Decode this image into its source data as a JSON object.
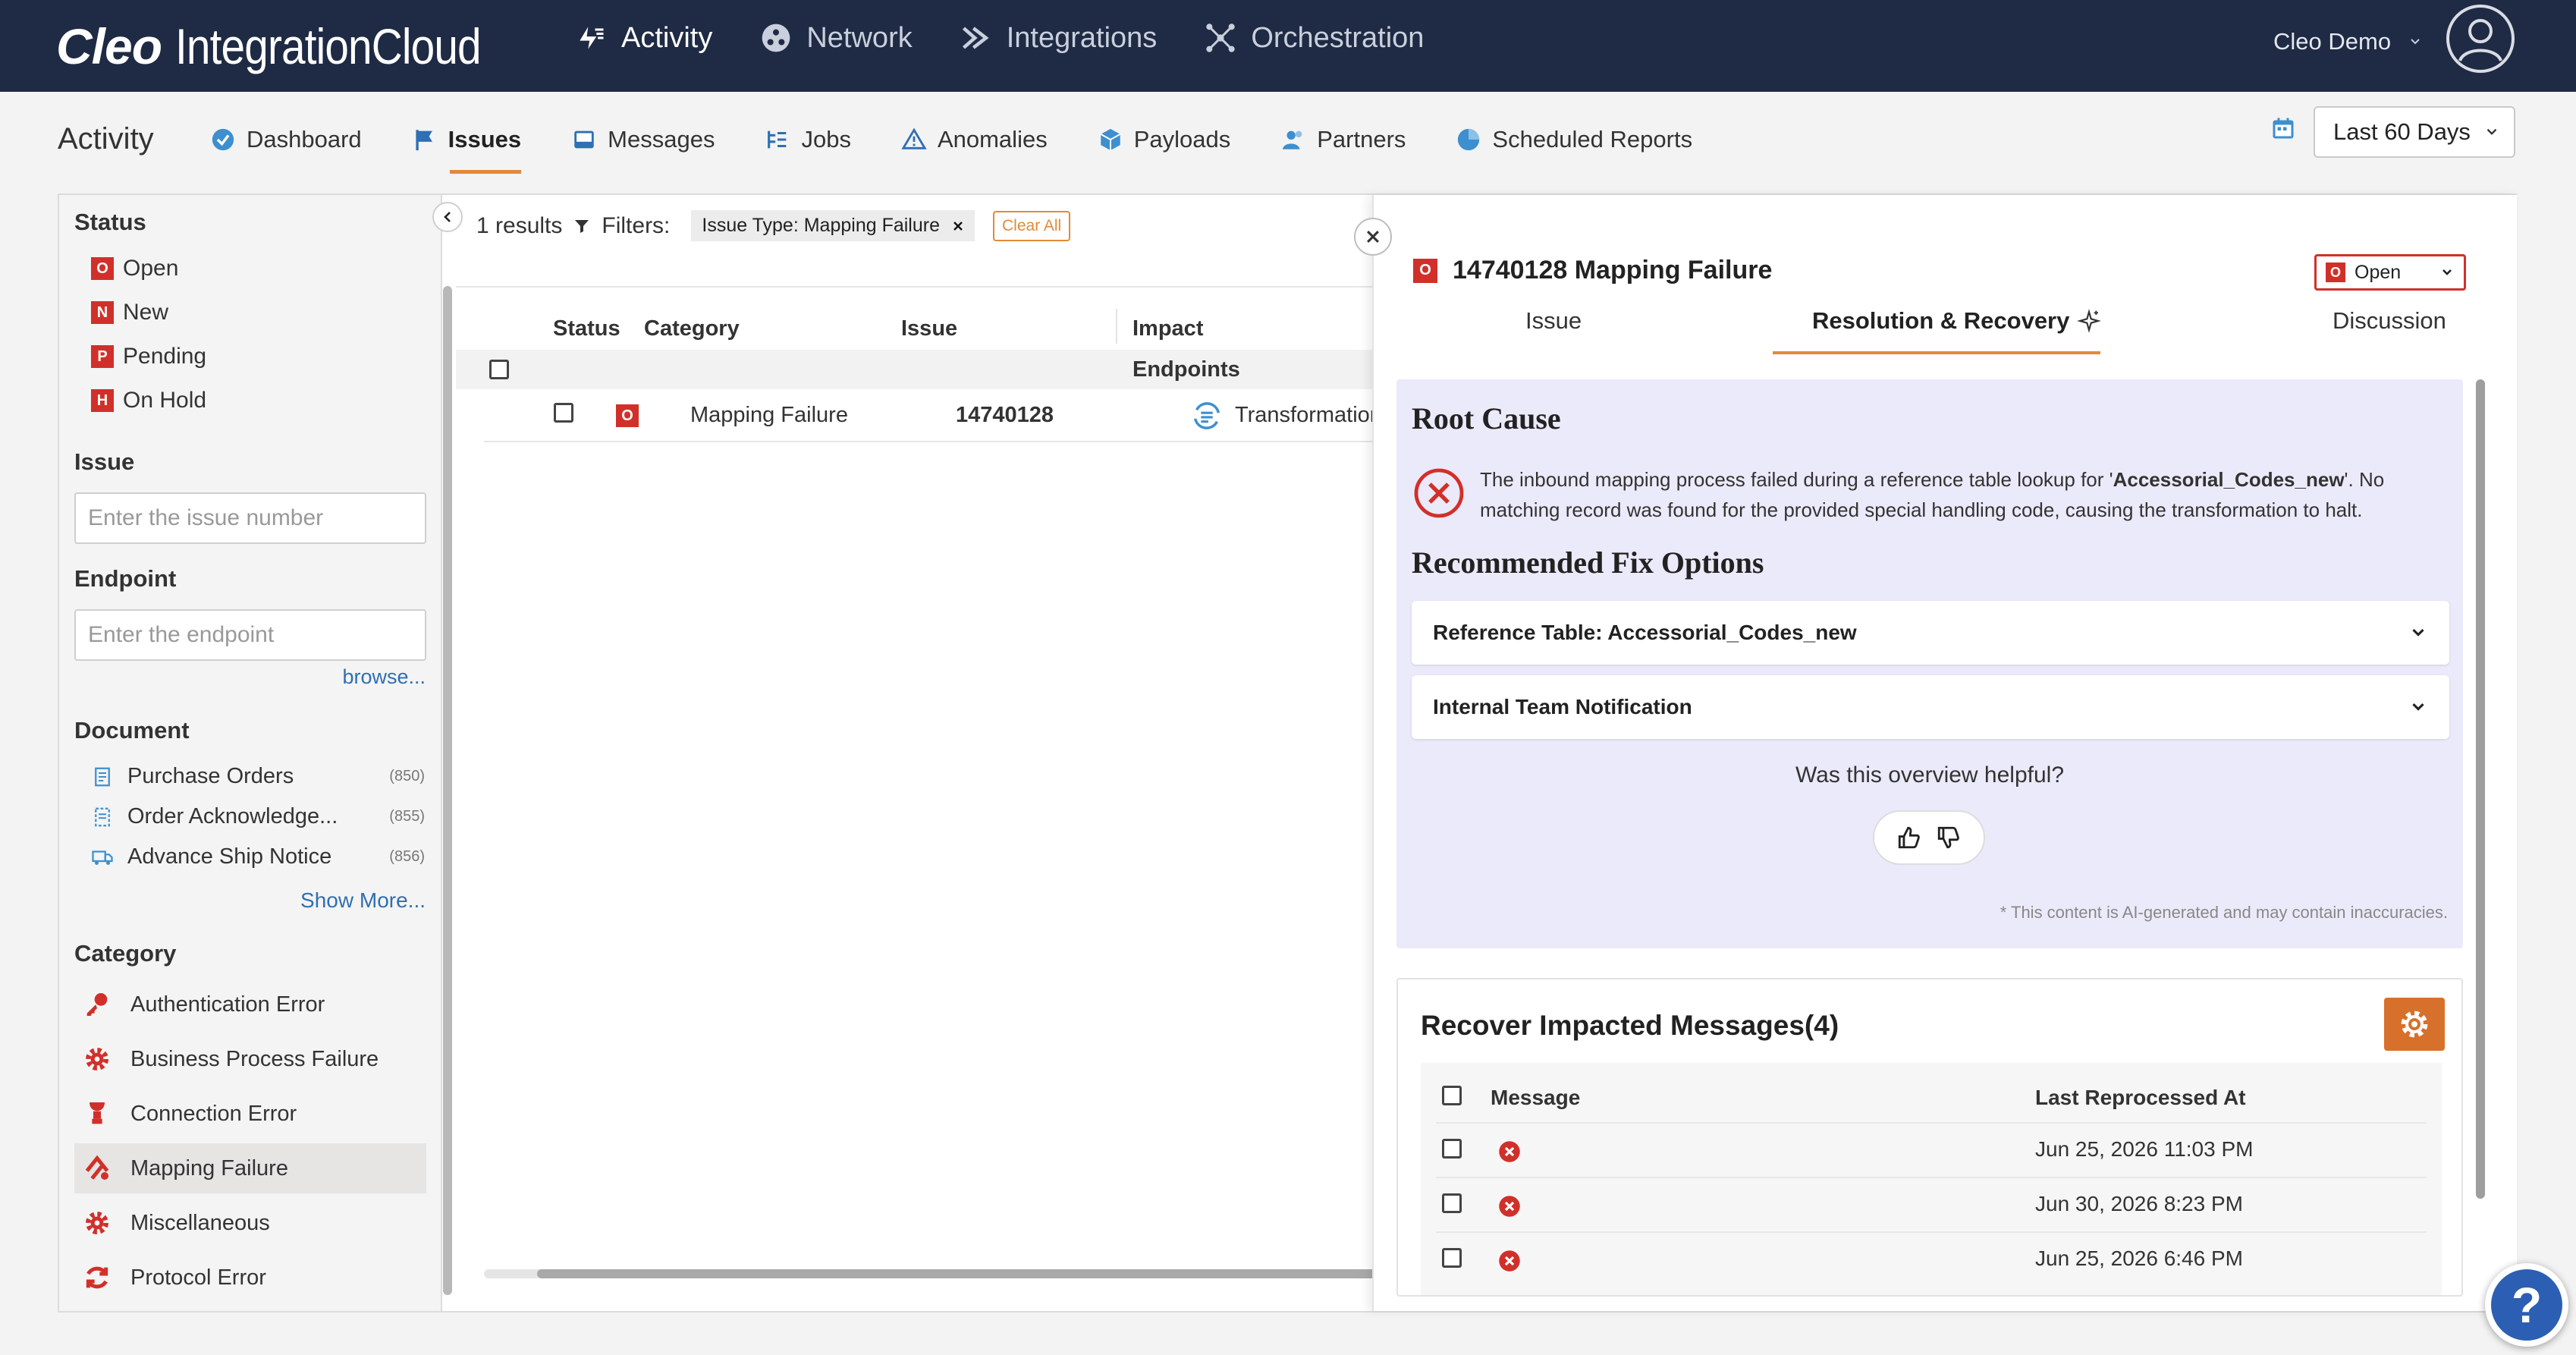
{
  "app": {
    "logo_part1": "Cleo",
    "logo_part2": "IntegrationCloud",
    "nav": [
      {
        "label": "Activity",
        "icon": "activity-icon"
      },
      {
        "label": "Network",
        "icon": "network-icon"
      },
      {
        "label": "Integrations",
        "icon": "integrations-icon"
      },
      {
        "label": "Orchestration",
        "icon": "orchestration-icon"
      }
    ],
    "user": "Cleo Demo"
  },
  "subnav": {
    "title": "Activity",
    "tabs": [
      {
        "label": "Dashboard",
        "icon": "dashboard-icon"
      },
      {
        "label": "Issues",
        "icon": "flag-icon"
      },
      {
        "label": "Messages",
        "icon": "inbox-icon"
      },
      {
        "label": "Jobs",
        "icon": "jobs-icon"
      },
      {
        "label": "Anomalies",
        "icon": "warning-icon"
      },
      {
        "label": "Payloads",
        "icon": "box-icon"
      },
      {
        "label": "Partners",
        "icon": "partners-icon"
      },
      {
        "label": "Scheduled Reports",
        "icon": "pie-chart-icon"
      }
    ],
    "date_range": "Last 60 Days"
  },
  "filters": {
    "status_heading": "Status",
    "statuses": [
      {
        "code": "O",
        "label": "Open"
      },
      {
        "code": "N",
        "label": "New"
      },
      {
        "code": "P",
        "label": "Pending"
      },
      {
        "code": "H",
        "label": "On Hold"
      }
    ],
    "issue_heading": "Issue",
    "issue_placeholder": "Enter the issue number",
    "endpoint_heading": "Endpoint",
    "endpoint_placeholder": "Enter the endpoint",
    "browse_label": "browse...",
    "document_heading": "Document",
    "documents": [
      {
        "label": "Purchase Orders",
        "count": "(850)"
      },
      {
        "label": "Order Acknowledge...",
        "count": "(855)"
      },
      {
        "label": "Advance Ship Notice",
        "count": "(856)"
      }
    ],
    "show_more": "Show More...",
    "category_heading": "Category",
    "categories": [
      {
        "label": "Authentication Error",
        "icon": "key-icon"
      },
      {
        "label": "Business Process Failure",
        "icon": "gear-icon"
      },
      {
        "label": "Connection Error",
        "icon": "plug-icon"
      },
      {
        "label": "Mapping Failure",
        "icon": "mapping-icon"
      },
      {
        "label": "Miscellaneous",
        "icon": "gear-icon"
      },
      {
        "label": "Protocol Error",
        "icon": "sync-icon"
      }
    ]
  },
  "results": {
    "count_text": "1 results",
    "filters_label": "Filters:",
    "chip_label": "Issue Type: Mapping Failure",
    "clear_all": "Clear All",
    "columns": {
      "status": "Status",
      "category": "Category",
      "issue": "Issue",
      "impact": "Impact",
      "endpoints": "Endpoints"
    },
    "rows": [
      {
        "status_code": "O",
        "category": "Mapping Failure",
        "issue": "14740128",
        "impact": "Transformation"
      }
    ]
  },
  "detail": {
    "title": "14740128 Mapping Failure",
    "status_code": "O",
    "status_value": "Open",
    "tabs": [
      "Issue",
      "Resolution & Recovery",
      "Discussion"
    ],
    "root_cause_heading": "Root Cause",
    "root_cause_pre": "The inbound mapping process failed during a reference table lookup for '",
    "root_cause_bold": "Accessorial_Codes_new",
    "root_cause_post": "'. No matching record was found for the provided special handling code, causing the transformation to halt.",
    "fix_heading": "Recommended Fix Options",
    "fix_options": [
      "Reference Table: Accessorial_Codes_new",
      "Internal Team Notification"
    ],
    "helpful_prompt": "Was this overview helpful?",
    "ai_disclaimer": "* This content is AI-generated and may contain inaccuracies.",
    "recover_title": "Recover Impacted Messages(4)",
    "recover_columns": {
      "message": "Message",
      "last": "Last Reprocessed At"
    },
    "recover_rows": [
      {
        "date": "Jun 25, 2026 11:03 PM"
      },
      {
        "date": "Jun 30, 2026 8:23 PM"
      },
      {
        "date": "Jun 25, 2026 6:46 PM"
      }
    ]
  },
  "help_label": "?",
  "colors": {
    "nav_bg": "#1f2a44",
    "accent": "#e08b3a",
    "error": "#d1302a",
    "panel_lavender": "#ebeafa",
    "link": "#2f6fb3"
  }
}
